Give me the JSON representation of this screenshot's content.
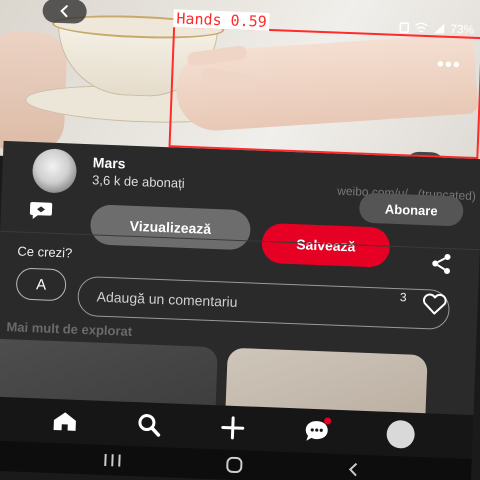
{
  "status_bar": {
    "battery_text": "73%"
  },
  "detection": {
    "label": "Hands 0.59",
    "color": "#ff2a2a"
  },
  "pin": {
    "watermark": "weibo.com/u/...(truncated)",
    "author": {
      "name": "Mars",
      "followers": "3,6 k de abonați"
    },
    "follow_label": "Abonare",
    "visit_label": "Vizualizează",
    "save_label": "Salvează",
    "accent_color": "#e60023"
  },
  "comments": {
    "prompt": "Ce crezi?",
    "user_initial": "A",
    "placeholder": "Adaugă un comentariu",
    "like_count": "3"
  },
  "explore": {
    "heading": "Mai mult de explorat"
  },
  "bottom_nav": [
    {
      "icon": "home-icon"
    },
    {
      "icon": "search-icon"
    },
    {
      "icon": "plus-icon"
    },
    {
      "icon": "chat-icon"
    },
    {
      "icon": "profile-avatar"
    }
  ],
  "system_nav": [
    {
      "icon": "recents-icon"
    },
    {
      "icon": "home-circle-icon"
    },
    {
      "icon": "back-chevron-icon"
    }
  ]
}
